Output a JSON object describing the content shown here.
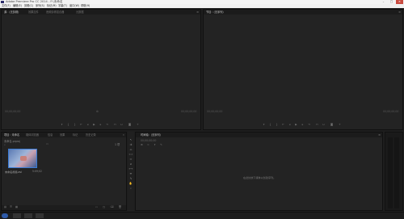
{
  "window": {
    "title": "Adobe Premiere Pro CC 2014 - F:\\未命名",
    "controls": {
      "minimize": "–",
      "maximize": "□",
      "close": "✕"
    }
  },
  "menu": [
    "文件(F)",
    "编辑(E)",
    "剪辑(C)",
    "序列(S)",
    "标记(M)",
    "字幕(T)",
    "窗口(W)",
    "帮助(H)"
  ],
  "source_panel": {
    "tabs": [
      "源：(无剪辑)",
      "效果控件",
      "音频剪辑混合器",
      "元数据"
    ],
    "timecode_left": "00;00;00;00",
    "timecode_right": "00;00;00;00"
  },
  "program_panel": {
    "tabs": [
      "节目：(无序列)"
    ],
    "timecode_left": "00;00;00;00",
    "timecode_right": "00;00;00;00"
  },
  "project_panel": {
    "tabs": [
      "项目：未命名",
      "媒体浏览器",
      "信息",
      "效果",
      "标记",
      "历史记录"
    ],
    "path": "未命名.prproj",
    "item_count": "1 项",
    "clip_name": "未命名视频.avi",
    "clip_duration": "5:09;02"
  },
  "timeline_panel": {
    "tabs": [
      "时间轴：(无序列)"
    ],
    "timecode": "00;00;00;00",
    "empty_message": "在此处放下媒体以创建序列。"
  },
  "colors": {
    "accent": "#3a7bd5",
    "panel_bg": "#232323",
    "background": "#1e1e1e"
  },
  "icons": {
    "transport": [
      "add-marker-icon",
      "mark-in-icon",
      "mark-out-icon",
      "go-to-in-icon",
      "step-back-icon",
      "play-icon",
      "step-forward-icon",
      "go-to-out-icon",
      "insert-icon",
      "overwrite-icon",
      "export-frame-icon",
      "plus-icon"
    ],
    "tools": [
      "selection-tool-icon",
      "track-select-tool-icon",
      "ripple-edit-tool-icon",
      "rolling-edit-tool-icon",
      "rate-stretch-tool-icon",
      "razor-tool-icon",
      "slip-tool-icon",
      "slide-tool-icon",
      "pen-tool-icon",
      "hand-tool-icon",
      "zoom-tool-icon"
    ]
  }
}
